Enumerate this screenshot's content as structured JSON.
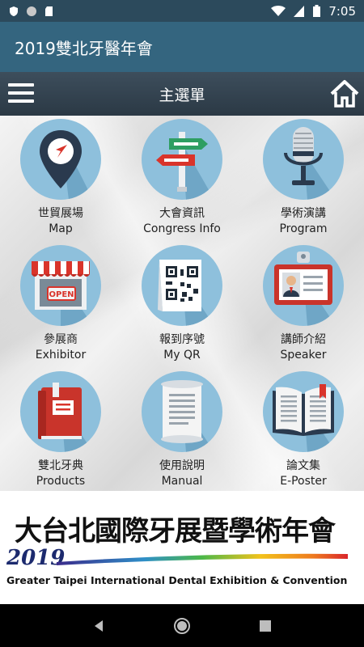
{
  "status_bar": {
    "time": "7:05",
    "icons": [
      "shield-icon",
      "circle-icon",
      "sd-card-icon",
      "wifi-icon",
      "signal-icon",
      "battery-icon"
    ]
  },
  "app_bar": {
    "title": "2019雙北牙醫年會"
  },
  "menu_bar": {
    "title": "主選單",
    "left_icon": "hamburger-menu-icon",
    "right_icon": "home-icon"
  },
  "tiles": [
    {
      "zh": "世貿展場",
      "en": "Map",
      "icon": "map-pin-icon"
    },
    {
      "zh": "大會資訊",
      "en": "Congress Info",
      "icon": "signpost-icon"
    },
    {
      "zh": "學術演講",
      "en": "Program",
      "icon": "microphone-icon"
    },
    {
      "zh": "參展商",
      "en": "Exhibitor",
      "icon": "open-shop-icon"
    },
    {
      "zh": "報到序號",
      "en": "My QR",
      "icon": "qr-code-icon"
    },
    {
      "zh": "講師介紹",
      "en": "Speaker",
      "icon": "id-badge-icon"
    },
    {
      "zh": "雙北牙典",
      "en": "Products",
      "icon": "red-book-icon"
    },
    {
      "zh": "使用說明",
      "en": "Manual",
      "icon": "scroll-document-icon"
    },
    {
      "zh": "論文集",
      "en": "E-Poster",
      "icon": "open-book-icon"
    }
  ],
  "banner": {
    "title_zh": "大台北國際牙展暨學術年會",
    "year": "2019",
    "title_en": "Greater Taipei International Dental Exhibition & Convention"
  },
  "nav_bar": {
    "icons": [
      "back-icon",
      "home-circle-icon",
      "recents-icon"
    ]
  },
  "colors": {
    "status_bar": "#2c4a5c",
    "app_bar": "#34657f",
    "menu_bar": "#2f3e4b",
    "tile_circle": "#8ec0dc"
  }
}
